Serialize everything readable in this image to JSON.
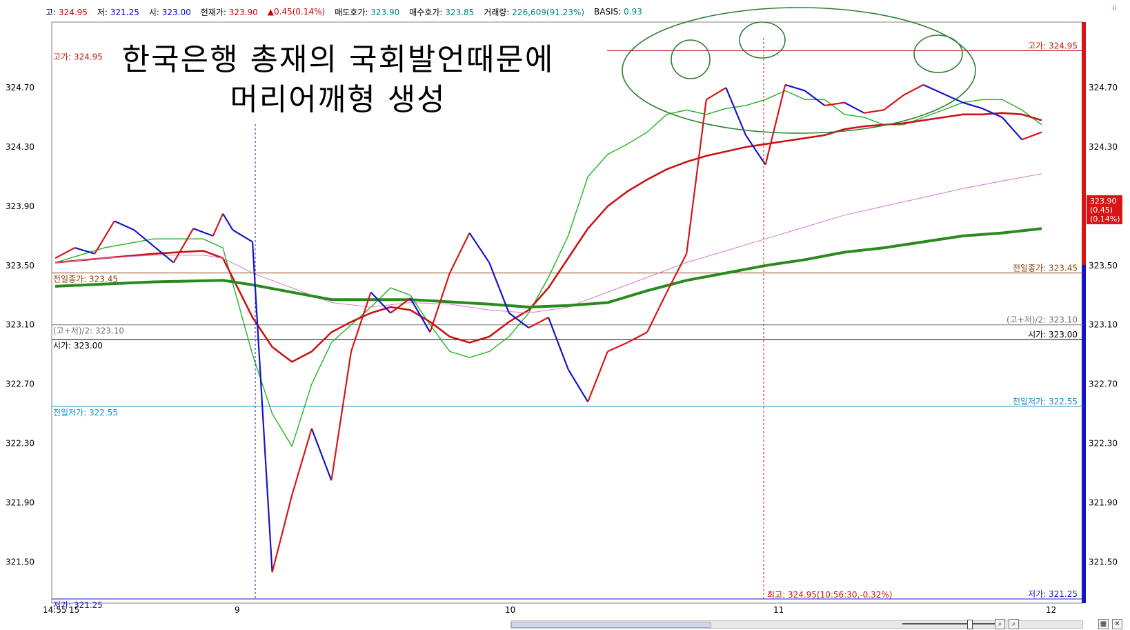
{
  "info": {
    "high_label": "고:",
    "high_value": "324.95",
    "low_label": "저:",
    "low_value": "321.25",
    "open_label": "시:",
    "open_value": "323.00",
    "current_label": "현재가:",
    "current_value": "323.90",
    "change": "▲0.45(0.14%)",
    "ask_label": "매도호가:",
    "ask_value": "323.90",
    "bid_label": "매수호가:",
    "bid_value": "323.85",
    "volume_label": "거래량:",
    "volume_value": "226,609(91.23%)",
    "basis_label": "BASIS:",
    "basis_value": "0.93"
  },
  "annotation": {
    "line1": "한국은행 총재의 국회발언때문에",
    "line2": "머리어깨형 생성"
  },
  "colors": {
    "up": "#d81414",
    "down": "#1414c8",
    "ma_fast": "#1eb41e",
    "ma_mid": "#c81414",
    "ma_slow": "#d27ad2",
    "ma_long": "#2a8a1e",
    "prev_close": "#8b4513",
    "prev_low": "#1e8cd2",
    "annotation_circle": "#2e7d32"
  },
  "chart_data": {
    "type": "line",
    "ylim": [
      321.25,
      325.05
    ],
    "yticks": [
      "324.70",
      "324.30",
      "323.90",
      "323.50",
      "323.10",
      "322.70",
      "322.30",
      "321.90",
      "321.50"
    ],
    "xticks": [
      "14:55",
      "15",
      "9",
      "10",
      "11",
      "12"
    ],
    "current_badge": [
      "323.90",
      "(0.45)",
      "(0.14%)"
    ],
    "reference_lines": [
      {
        "label": "고가: 324.95",
        "value": 324.95
      },
      {
        "label": "전일종가: 323.45",
        "value": 323.45
      },
      {
        "label": "(고+저)/2: 323.10",
        "value": 323.1
      },
      {
        "label": "시가: 323.00",
        "value": 323.0
      },
      {
        "label": "전일저가: 322.55",
        "value": 322.55
      },
      {
        "label": "저가: 321.25",
        "value": 321.25
      }
    ],
    "high_marker": "최고: 324.95(10:56:30,-0.32%)",
    "series": [
      {
        "role": "price",
        "x": [
          0,
          2,
          4,
          6,
          8,
          10,
          12,
          14,
          16,
          17,
          18,
          20,
          22,
          24,
          26,
          28,
          30,
          32,
          34,
          36,
          38,
          40,
          42,
          44,
          46,
          48,
          50,
          52,
          54,
          56,
          58,
          60,
          62,
          64,
          66,
          68,
          70,
          72,
          74,
          76,
          78,
          80,
          82,
          84,
          86,
          88,
          90,
          92,
          94,
          96,
          98,
          100
        ],
        "values": [
          323.55,
          323.62,
          323.58,
          323.8,
          323.74,
          323.63,
          323.52,
          323.75,
          323.7,
          323.85,
          323.74,
          323.66,
          321.43,
          321.95,
          322.4,
          322.05,
          322.92,
          323.32,
          323.18,
          323.28,
          323.05,
          323.45,
          323.72,
          323.52,
          323.18,
          323.08,
          323.15,
          322.8,
          322.58,
          322.92,
          322.98,
          323.05,
          323.32,
          323.58,
          324.62,
          324.7,
          324.38,
          324.18,
          324.72,
          324.68,
          324.58,
          324.6,
          324.53,
          324.55,
          324.65,
          324.72,
          324.66,
          324.6,
          324.56,
          324.5,
          324.35,
          324.4
        ]
      },
      {
        "role": "ma_fast",
        "x": [
          0,
          5,
          10,
          15,
          17,
          20,
          22,
          24,
          26,
          28,
          30,
          32,
          34,
          36,
          38,
          40,
          42,
          44,
          46,
          48,
          50,
          52,
          54,
          56,
          58,
          60,
          62,
          64,
          66,
          68,
          70,
          72,
          74,
          76,
          78,
          80,
          82,
          84,
          86,
          88,
          90,
          92,
          94,
          96,
          98,
          100
        ],
        "values": [
          323.52,
          323.62,
          323.68,
          323.68,
          323.62,
          322.9,
          322.5,
          322.28,
          322.7,
          322.98,
          323.1,
          323.22,
          323.35,
          323.3,
          323.1,
          322.92,
          322.88,
          322.92,
          323.02,
          323.18,
          323.42,
          323.7,
          324.1,
          324.25,
          324.32,
          324.4,
          324.52,
          324.55,
          324.52,
          324.56,
          324.58,
          324.62,
          324.68,
          324.62,
          324.62,
          324.52,
          324.5,
          324.45,
          324.45,
          324.5,
          324.55,
          324.6,
          324.62,
          324.62,
          324.55,
          324.45
        ]
      },
      {
        "role": "ma_mid",
        "x": [
          0,
          5,
          10,
          15,
          17,
          20,
          22,
          24,
          26,
          28,
          30,
          32,
          34,
          36,
          38,
          40,
          42,
          44,
          46,
          48,
          50,
          52,
          54,
          56,
          58,
          60,
          62,
          64,
          66,
          68,
          70,
          72,
          74,
          76,
          78,
          80,
          82,
          84,
          86,
          88,
          90,
          92,
          94,
          96,
          98,
          100
        ],
        "values": [
          323.52,
          323.55,
          323.58,
          323.6,
          323.55,
          323.15,
          322.95,
          322.85,
          322.92,
          323.05,
          323.12,
          323.18,
          323.22,
          323.2,
          323.12,
          323.02,
          322.98,
          323.02,
          323.12,
          323.2,
          323.35,
          323.55,
          323.75,
          323.9,
          324.0,
          324.08,
          324.15,
          324.2,
          324.24,
          324.27,
          324.3,
          324.32,
          324.34,
          324.36,
          324.38,
          324.42,
          324.44,
          324.45,
          324.46,
          324.48,
          324.5,
          324.52,
          324.52,
          324.53,
          324.52,
          324.48
        ]
      },
      {
        "role": "ma_slow",
        "x": [
          0,
          5,
          10,
          15,
          17,
          20,
          24,
          28,
          32,
          36,
          40,
          44,
          48,
          52,
          56,
          60,
          64,
          68,
          72,
          76,
          80,
          84,
          88,
          92,
          96,
          100
        ],
        "values": [
          323.52,
          323.55,
          323.57,
          323.57,
          323.55,
          323.45,
          323.35,
          323.25,
          323.22,
          323.25,
          323.24,
          323.2,
          323.18,
          323.22,
          323.32,
          323.42,
          323.52,
          323.6,
          323.68,
          323.76,
          323.84,
          323.9,
          323.96,
          324.02,
          324.07,
          324.12
        ]
      },
      {
        "role": "ma_long",
        "x": [
          0,
          10,
          17,
          20,
          28,
          36,
          44,
          48,
          52,
          56,
          60,
          64,
          68,
          72,
          76,
          80,
          84,
          88,
          92,
          96,
          100
        ],
        "values": [
          323.36,
          323.39,
          323.4,
          323.37,
          323.27,
          323.27,
          323.24,
          323.22,
          323.23,
          323.25,
          323.33,
          323.4,
          323.45,
          323.5,
          323.54,
          323.59,
          323.62,
          323.66,
          323.7,
          323.72,
          323.75
        ]
      }
    ]
  }
}
